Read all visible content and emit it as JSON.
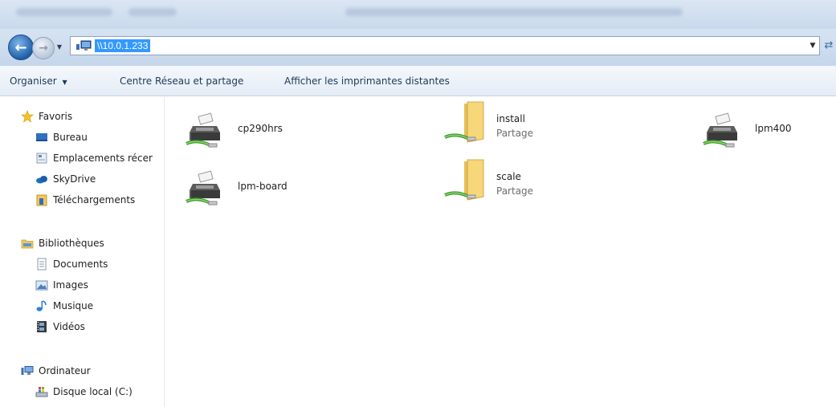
{
  "address": {
    "path": "\\\\10.0.1.233"
  },
  "toolbar": {
    "organize_label": "Organiser",
    "network_center_label": "Centre Réseau et partage",
    "printers_label": "Afficher les imprimantes distantes"
  },
  "sidebar": {
    "favorites": {
      "label": "Favoris",
      "items": [
        {
          "label": "Bureau",
          "icon": "desktop-icon"
        },
        {
          "label": "Emplacements récer",
          "icon": "recent-places-icon"
        },
        {
          "label": "SkyDrive",
          "icon": "skydrive-icon"
        },
        {
          "label": "Téléchargements",
          "icon": "downloads-icon"
        }
      ]
    },
    "libraries": {
      "label": "Bibliothèques",
      "items": [
        {
          "label": "Documents",
          "icon": "documents-icon"
        },
        {
          "label": "Images",
          "icon": "images-icon"
        },
        {
          "label": "Musique",
          "icon": "music-icon"
        },
        {
          "label": "Vidéos",
          "icon": "videos-icon"
        }
      ]
    },
    "computer": {
      "label": "Ordinateur",
      "items": [
        {
          "label": "Disque local (C:)",
          "icon": "local-disk-icon"
        }
      ]
    }
  },
  "items": [
    {
      "name": "cp290hrs",
      "subtitle": "",
      "type": "printer"
    },
    {
      "name": "install",
      "subtitle": "Partage",
      "type": "share"
    },
    {
      "name": "lpm400",
      "subtitle": "",
      "type": "printer"
    },
    {
      "name": "lpm-board",
      "subtitle": "",
      "type": "printer"
    },
    {
      "name": "scale",
      "subtitle": "Partage",
      "type": "share"
    }
  ],
  "colors": {
    "selection": "#3399ff",
    "toolbar_text": "#1e395b",
    "subtitle_text": "#6d6d6d"
  }
}
